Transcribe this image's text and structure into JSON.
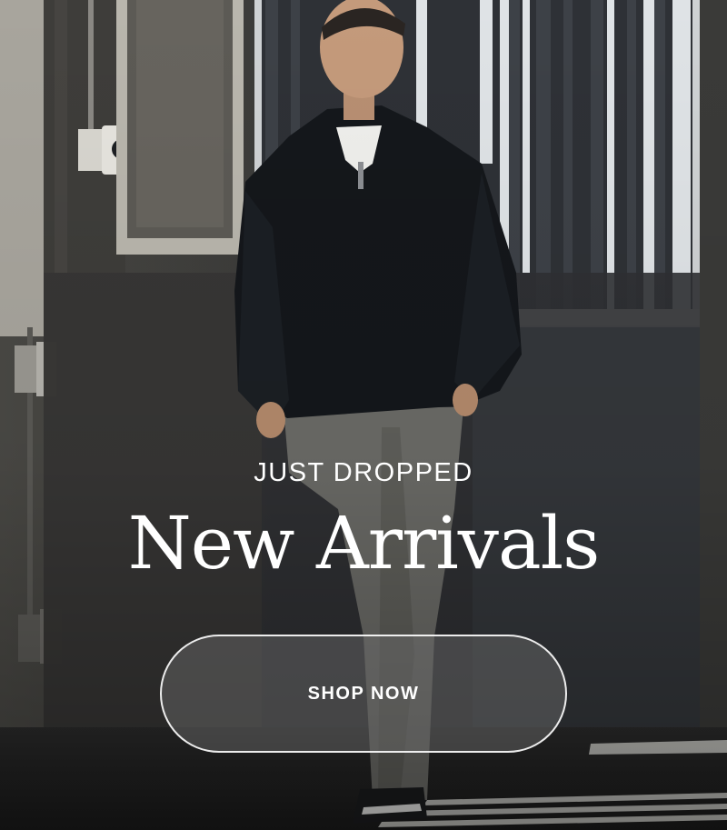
{
  "hero": {
    "eyebrow": "JUST DROPPED",
    "headline": "New Arrivals",
    "cta_label": "SHOP NOW"
  },
  "colors": {
    "text": "#ffffff",
    "cta_fill": "#6e6e6e",
    "background": "#262626"
  }
}
